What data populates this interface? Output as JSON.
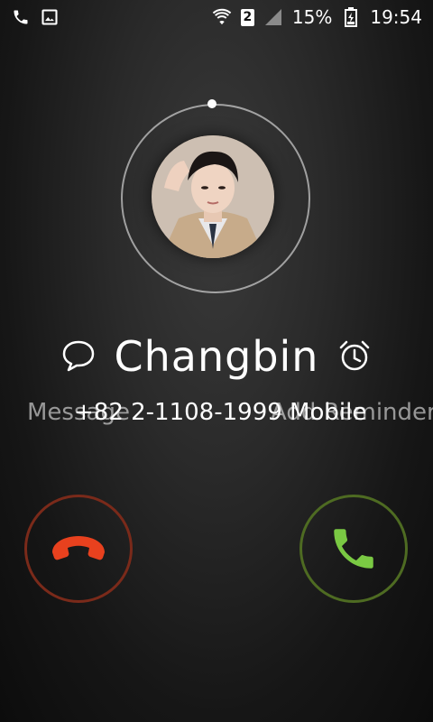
{
  "status_bar": {
    "left_icons": [
      "phone-icon",
      "image-icon"
    ],
    "right_icons": [
      "wifi-icon",
      "sim-2-icon",
      "signal-icon",
      "battery-icon"
    ],
    "sim_label": "2",
    "battery": "15%",
    "time": "19:54"
  },
  "caller": {
    "name": "Changbin",
    "number": "+82 2-1108-1999",
    "number_type": "Mobile"
  },
  "actions": {
    "message_label": "Message",
    "reminder_label": "Add Reminder"
  },
  "colors": {
    "decline": "#e8411e",
    "answer": "#7ac943"
  }
}
